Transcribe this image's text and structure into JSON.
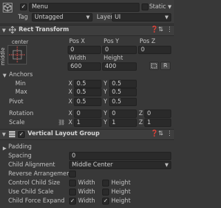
{
  "gameobject": {
    "name": "Menu",
    "static_label": "Static",
    "tag_label": "Tag",
    "tag_value": "Untagged",
    "layer_label": "Layer",
    "layer_value": "UI"
  },
  "rect_transform": {
    "title": "Rect Transform",
    "anchor_preset_top": "center",
    "anchor_preset_side": "middle",
    "col_posx": "Pos X",
    "col_posy": "Pos Y",
    "col_posz": "Pos Z",
    "posx": "0",
    "posy": "0",
    "posz": "0",
    "col_width": "Width",
    "col_height": "Height",
    "width": "600",
    "height": "400",
    "r_button": "R",
    "anchors_label": "Anchors",
    "min_label": "Min",
    "min_x": "0.5",
    "min_y": "0.5",
    "max_label": "Max",
    "max_x": "0.5",
    "max_y": "0.5",
    "pivot_label": "Pivot",
    "pivot_x": "0.5",
    "pivot_y": "0.5",
    "rotation_label": "Rotation",
    "rot_x": "0",
    "rot_y": "0",
    "rot_z": "0",
    "scale_label": "Scale",
    "scale_x": "1",
    "scale_y": "1",
    "scale_z": "1",
    "axis_x": "X",
    "axis_y": "Y",
    "axis_z": "Z"
  },
  "vlg": {
    "title": "Vertical Layout Group",
    "padding_label": "Padding",
    "spacing_label": "Spacing",
    "spacing_value": "0",
    "child_alignment_label": "Child Alignment",
    "child_alignment_value": "Middle Center",
    "reverse_label": "Reverse Arrangement",
    "control_size_label": "Control Child Size",
    "use_scale_label": "Use Child Scale",
    "force_expand_label": "Child Force Expand",
    "width_label": "Width",
    "height_label": "Height"
  },
  "colors": {
    "background": "#383838",
    "field": "#2a2a2a",
    "header": "#3e3e3e",
    "anchor_red": "#d9534f"
  }
}
